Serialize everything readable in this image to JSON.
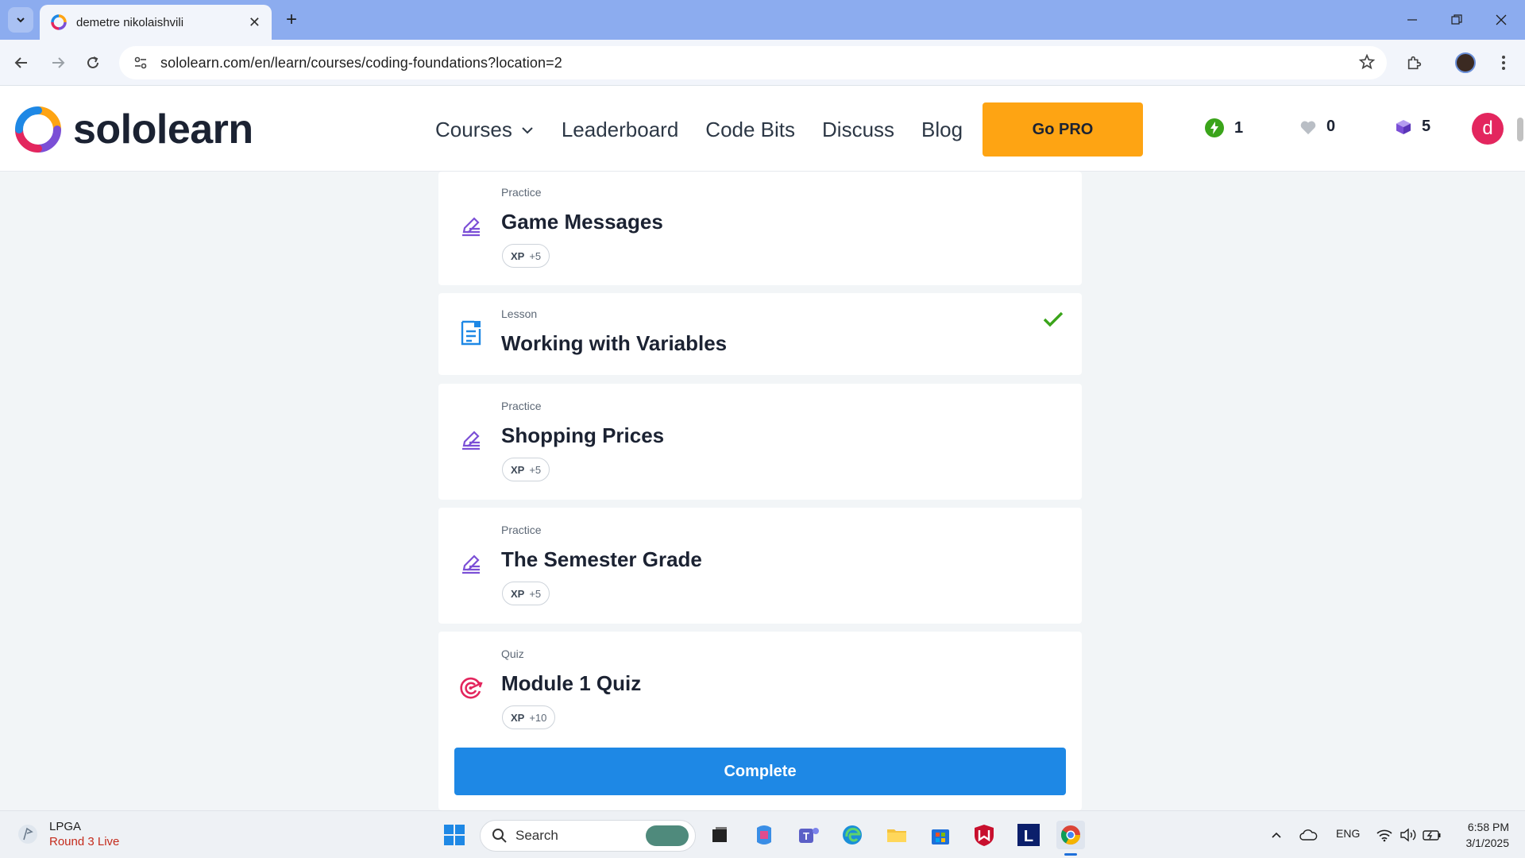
{
  "browser": {
    "tab_title": "demetre nikolaishvili",
    "url": "sololearn.com/en/learn/courses/coding-foundations?location=2"
  },
  "site": {
    "logo_text": "sololearn",
    "nav": {
      "courses": "Courses",
      "leaderboard": "Leaderboard",
      "code_bits": "Code Bits",
      "discuss": "Discuss",
      "blog": "Blog"
    },
    "go_pro": "Go PRO",
    "stats": {
      "streak": "1",
      "hearts": "0",
      "gems": "5"
    },
    "avatar_letter": "d"
  },
  "lessons": [
    {
      "kind": "Practice",
      "title": "Game Messages",
      "xp_label": "XP",
      "xp_value": "+5",
      "icon": "pencil-icon",
      "completed": false
    },
    {
      "kind": "Lesson",
      "title": "Working with Variables",
      "icon": "lesson-icon",
      "completed": true
    },
    {
      "kind": "Practice",
      "title": "Shopping Prices",
      "xp_label": "XP",
      "xp_value": "+5",
      "icon": "pencil-icon",
      "completed": false
    },
    {
      "kind": "Practice",
      "title": "The Semester Grade",
      "xp_label": "XP",
      "xp_value": "+5",
      "icon": "pencil-icon",
      "completed": false
    },
    {
      "kind": "Quiz",
      "title": "Module 1 Quiz",
      "xp_label": "XP",
      "xp_value": "+10",
      "icon": "target-icon",
      "completed": false
    }
  ],
  "complete_button": "Complete",
  "colors": {
    "brand_orange": "#fea413",
    "primary_blue": "#1e88e5",
    "practice_purple": "#7b4fd6",
    "lesson_blue": "#1e88e5",
    "quiz_red": "#e3265e",
    "check_green": "#3aa41a"
  },
  "taskbar": {
    "weather_title": "LPGA",
    "weather_sub": "Round 3 Live",
    "search_label": "Search",
    "lang": "ENG",
    "time": "6:58 PM",
    "date": "3/1/2025"
  }
}
